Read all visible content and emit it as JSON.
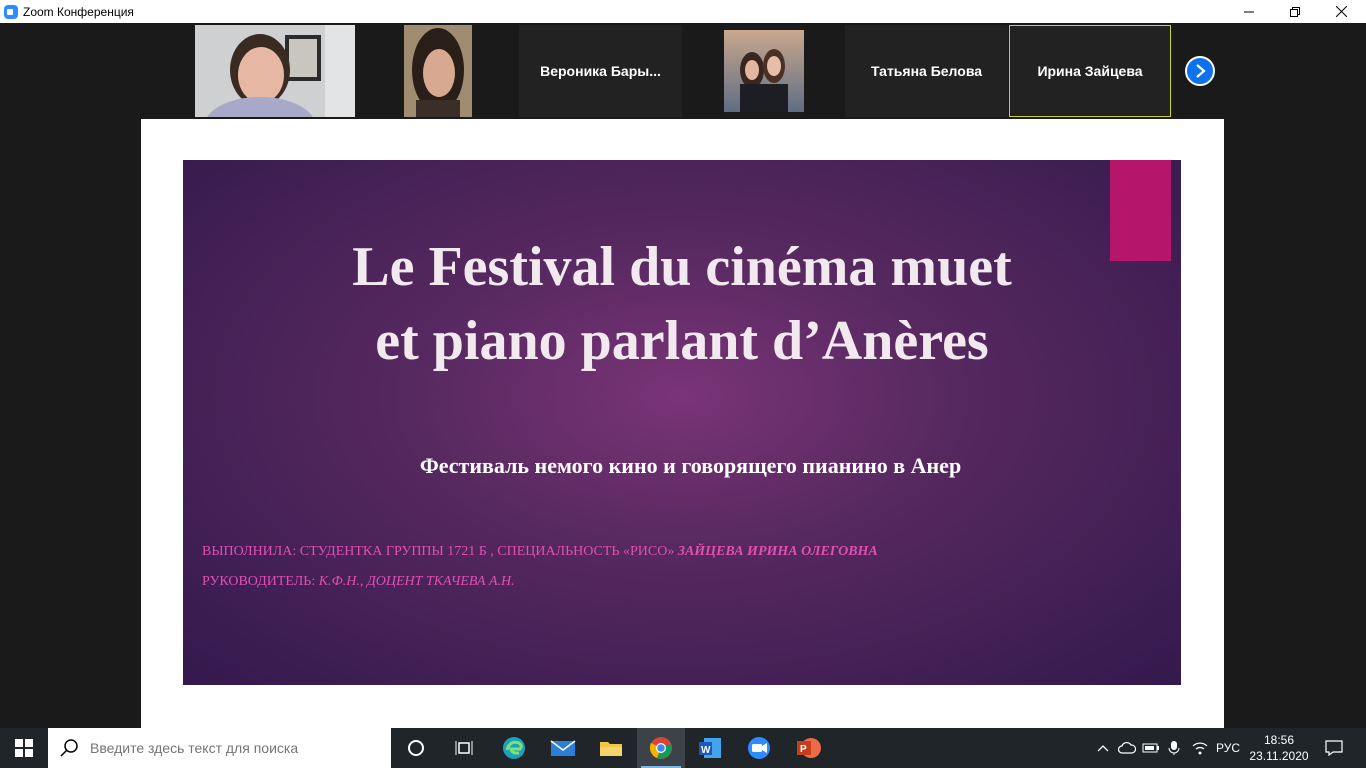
{
  "window": {
    "title": "Zoom Конференция",
    "controls": [
      "minimize",
      "restore",
      "close"
    ]
  },
  "gallery": {
    "participants": [
      {
        "type": "video"
      },
      {
        "type": "video"
      },
      {
        "type": "name",
        "name": "Вероника  Бары..."
      },
      {
        "type": "video"
      },
      {
        "type": "name",
        "name": "Татьяна Белова"
      },
      {
        "type": "name",
        "name": "Ирина Зайцева",
        "active": true
      }
    ],
    "next_icon": "chevron-right-icon",
    "accent": "#0e72ed",
    "active_border": "#c9d22b"
  },
  "slide": {
    "title_line1": "Le Festival du cinéma muet",
    "title_line2": "et piano parlant d’Anères",
    "subtitle": "Фестиваль немого кино и говорящего пианино в Анер",
    "author_label": "ВЫПОЛНИЛА: СТУДЕНТКА ГРУППЫ 1721 Б , СПЕЦИАЛЬНОСТЬ «РИСО» ",
    "author_name": "ЗАЙЦЕВА ИРИНА ОЛЕГОВНА",
    "supervisor_label": "РУКОВОДИТЕЛЬ:  ",
    "supervisor_name": "К.Ф.Н., ДОЦЕНТ ТКАЧЕВА А.Н.",
    "tag_color": "#b5156b",
    "text_color": "#e14fb0"
  },
  "taskbar": {
    "search_placeholder": "Введите здесь текст для поиска",
    "apps": [
      "task-view",
      "edge",
      "mail",
      "file-explorer",
      "chrome",
      "word",
      "zoom",
      "powerpoint"
    ],
    "active_app": "chrome",
    "tray": {
      "language": "РУС",
      "time": "18:56",
      "date": "23.11.2020"
    }
  }
}
